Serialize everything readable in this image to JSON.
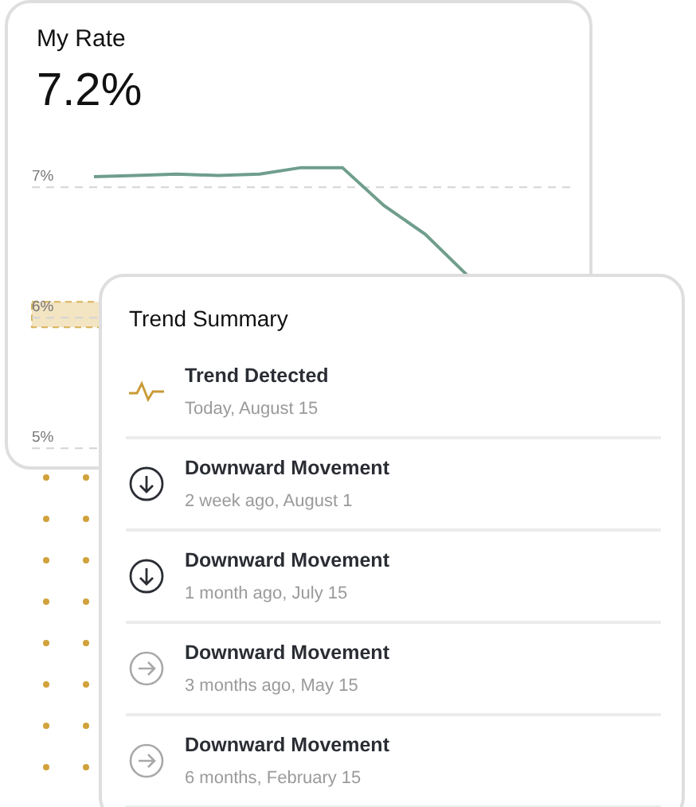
{
  "rate_card": {
    "title": "My Rate",
    "value": "7.2%",
    "chart_data": {
      "type": "line",
      "grid": true,
      "ylim": [
        4.84,
        8.41
      ],
      "yticks": [
        {
          "value": 7,
          "label": "7%"
        },
        {
          "value": 6,
          "label": "6%"
        },
        {
          "value": 5,
          "label": "5%"
        }
      ],
      "series": [
        {
          "color": "#6f9e8c",
          "values": [
            null,
            7.08,
            7.09,
            7.1,
            7.09,
            7.1,
            7.15,
            7.15,
            6.86,
            6.64,
            6.33,
            null,
            null
          ]
        }
      ]
    }
  },
  "trend_summary": {
    "title": "Trend Summary",
    "items": [
      {
        "kind": "trend",
        "title": "Trend Detected",
        "subtitle": "Today, August 15"
      },
      {
        "kind": "down",
        "title": "Downward Movement",
        "subtitle": "2 week ago, August 1"
      },
      {
        "kind": "down",
        "title": "Downward Movement",
        "subtitle": "1 month ago, July 15"
      },
      {
        "kind": "right",
        "title": "Downward Movement",
        "subtitle": "3 months ago, May 15"
      },
      {
        "kind": "right",
        "title": "Downward Movement",
        "subtitle": "6 months, February 15"
      }
    ]
  }
}
